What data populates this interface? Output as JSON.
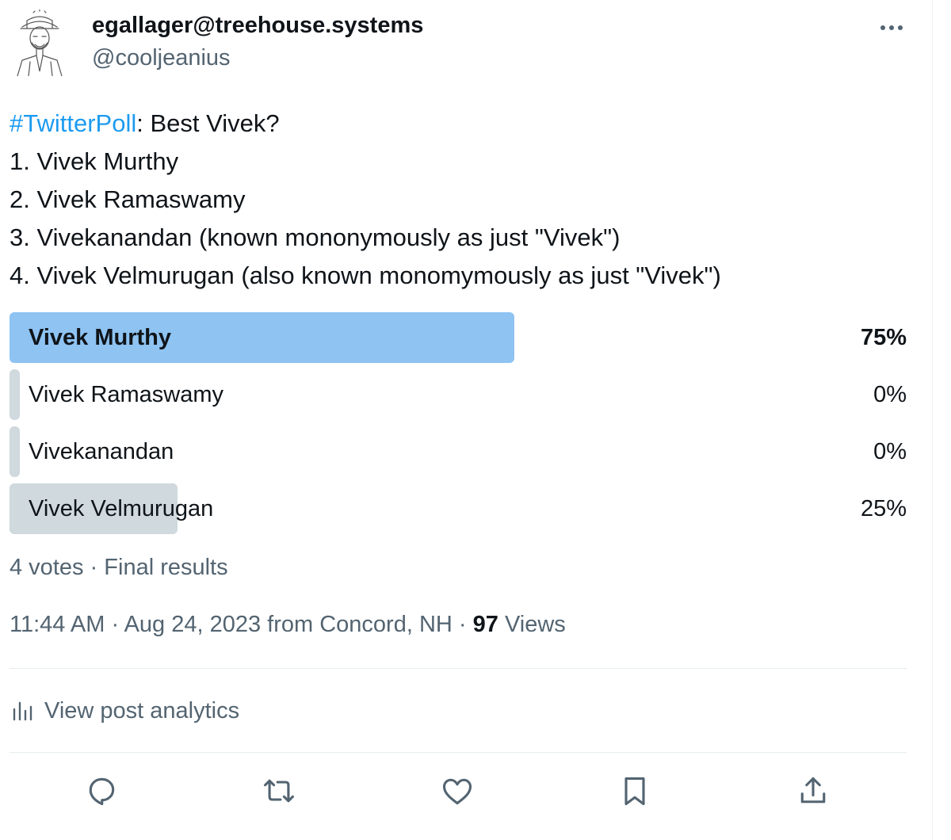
{
  "author": {
    "display_name": "egallager@treehouse.systems",
    "handle": "@cooljeanius"
  },
  "tweet": {
    "hashtag": "#TwitterPoll",
    "title_rest": ": Best Vivek?",
    "lines": [
      "1. Vivek Murthy",
      "2. Vivek Ramaswamy",
      "3. Vivekanandan (known mononymously as just \"Vivek\")",
      "4. Vivek Velmurugan (also known monomymously as just \"Vivek\")"
    ]
  },
  "poll": {
    "options": [
      {
        "label": "Vivek Murthy",
        "percent_text": "75%",
        "percent": 75,
        "winner": true
      },
      {
        "label": "Vivek Ramaswamy",
        "percent_text": "0%",
        "percent": 0,
        "winner": false
      },
      {
        "label": "Vivekanandan",
        "percent_text": "0%",
        "percent": 0,
        "winner": false
      },
      {
        "label": "Vivek Velmurugan",
        "percent_text": "25%",
        "percent": 25,
        "winner": false
      }
    ],
    "votes": "4 votes",
    "separator": " · ",
    "status": "Final results"
  },
  "meta": {
    "time": "11:44 AM",
    "sep1": " · ",
    "date": "Aug 24, 2023",
    "location": " from Concord, NH",
    "sep2": " · ",
    "views_count": "97",
    "views_label": " Views"
  },
  "analytics": {
    "label": "View post analytics"
  },
  "actions": {
    "icons": [
      "reply-icon",
      "retweet-icon",
      "like-icon",
      "bookmark-icon",
      "share-icon"
    ]
  },
  "colors": {
    "accent": "#1d9bf0",
    "winner_bar": "#8ec3f2",
    "loser_bar": "#cfd9de",
    "secondary_text": "#536471"
  }
}
